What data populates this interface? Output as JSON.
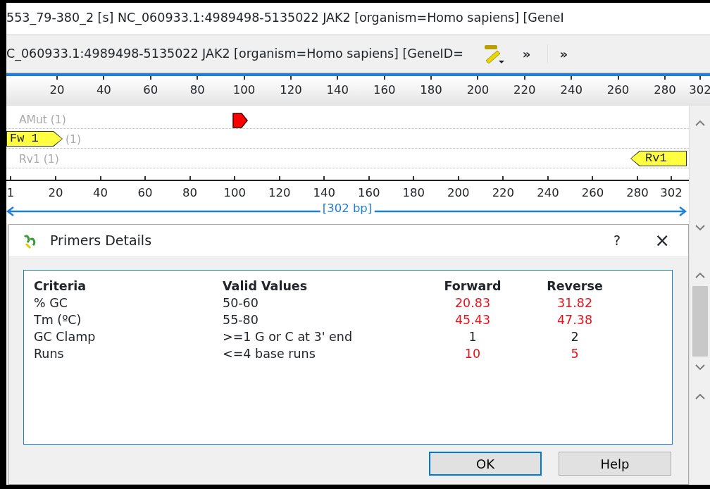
{
  "window": {
    "title": "553_79-380_2 [s] NC_060933.1:4989498-5135022 JAK2 [organism=Homo sapiens] [GeneI"
  },
  "toolbar": {
    "text": "C_060933.1:4989498-5135022 JAK2 [organism=Homo sapiens] [GeneID=",
    "overflow": [
      "»",
      "»"
    ]
  },
  "ruler_top": {
    "labels": [
      "20",
      "40",
      "60",
      "80",
      "100",
      "120",
      "140",
      "160",
      "180",
      "200",
      "220",
      "240",
      "260",
      "280",
      "302"
    ]
  },
  "map": {
    "tracks": [
      {
        "kind": "mutation",
        "label": "AMut (1)"
      },
      {
        "kind": "forward",
        "primer": "Fw 1",
        "label": "(1)"
      },
      {
        "kind": "reverse",
        "label": "Rv1 (1)",
        "primer": "Rv1"
      }
    ],
    "ruler_labels": [
      "1",
      "20",
      "40",
      "60",
      "80",
      "100",
      "120",
      "140",
      "160",
      "180",
      "200",
      "220",
      "240",
      "260",
      "280",
      "302"
    ],
    "length": "[302 bp]"
  },
  "dialog": {
    "title": "Primers Details",
    "help": "?",
    "close": "×",
    "columns": [
      "Criteria",
      "Valid Values",
      "Forward",
      "Reverse"
    ],
    "rows": [
      {
        "criteria": "% GC",
        "valid": "50-60",
        "forward": {
          "value": "20.83",
          "fails": true
        },
        "reverse": {
          "value": "31.82",
          "fails": true
        }
      },
      {
        "criteria": "Tm (ºC)",
        "valid": "55-80",
        "forward": {
          "value": "45.43",
          "fails": true
        },
        "reverse": {
          "value": "47.38",
          "fails": true
        }
      },
      {
        "criteria": "GC Clamp",
        "valid": ">=1 G or C at 3' end",
        "forward": {
          "value": "1",
          "fails": false
        },
        "reverse": {
          "value": "2",
          "fails": false
        }
      },
      {
        "criteria": "Runs",
        "valid": "<=4 base runs",
        "forward": {
          "value": "10",
          "fails": true
        },
        "reverse": {
          "value": "5",
          "fails": true
        }
      }
    ],
    "buttons": [
      {
        "label": "OK",
        "default": true
      },
      {
        "label": "Help",
        "default": false
      }
    ]
  }
}
